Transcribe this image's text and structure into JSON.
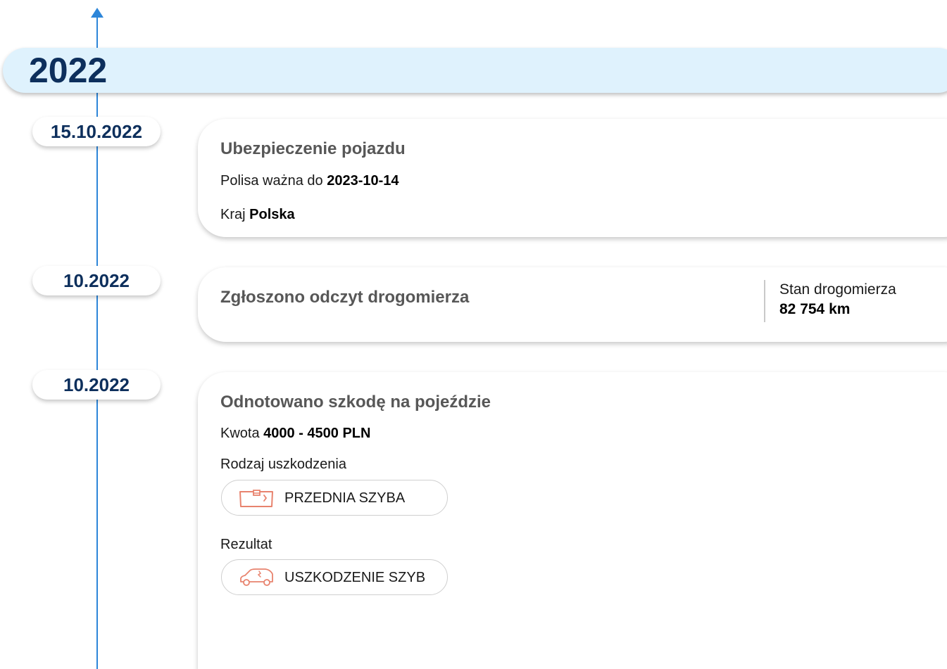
{
  "timeline": {
    "year": "2022",
    "accent_color": "#2d86d9",
    "banner_color": "#dff2fd",
    "year_color": "#0d2f5c",
    "icon_color": "#e8836e"
  },
  "events": [
    {
      "date": "15.10.2022",
      "title": "Ubezpieczenie pojazdu",
      "policy_label": "Polisa ważna do",
      "policy_value": "2023-10-14",
      "country_label": "Kraj",
      "country_value": "Polska"
    },
    {
      "date": "10.2022",
      "title": "Zgłoszono odczyt drogomierza",
      "odometer_label": "Stan drogomierza",
      "odometer_value": "82 754 km"
    },
    {
      "date": "10.2022",
      "title": "Odnotowano szkodę na pojeździe",
      "amount_label": "Kwota",
      "amount_value": "4000 - 4500 PLN",
      "damage_type_label": "Rodzaj uszkodzenia",
      "damage_type_chip": {
        "icon": "windshield-icon",
        "label": "PRZEDNIA SZYBA"
      },
      "result_label": "Rezultat",
      "result_chip": {
        "icon": "car-glass-damage-icon",
        "label": "USZKODZENIE SZYB"
      }
    }
  ]
}
